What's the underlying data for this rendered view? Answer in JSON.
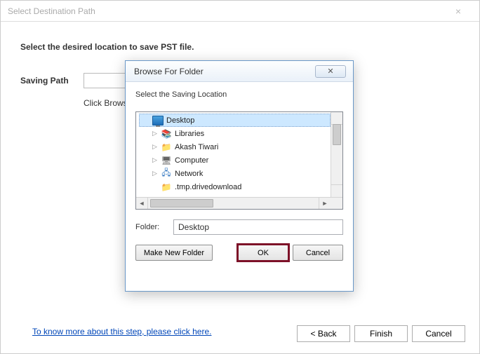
{
  "parent": {
    "title": "Select Destination Path",
    "instruction": "Select the desired location to save PST file.",
    "path_label": "Saving Path",
    "hint": "Click Browse an",
    "learn_link": "To know more about this step, please click here.",
    "back_label": "< Back",
    "finish_label": "Finish",
    "cancel_label": "Cancel"
  },
  "dialog": {
    "title": "Browse For Folder",
    "close_glyph": "✕",
    "instruction": "Select the Saving Location",
    "folder_label": "Folder:",
    "folder_value": "Desktop",
    "make_new_label": "Make New Folder",
    "ok_label": "OK",
    "cancel_label": "Cancel",
    "tree": [
      {
        "label": "Desktop",
        "icon": "monitor",
        "expandable": false,
        "selected": true,
        "indent": 0
      },
      {
        "label": "Libraries",
        "icon": "libraries",
        "expandable": true,
        "selected": false,
        "indent": 1
      },
      {
        "label": "Akash Tiwari",
        "icon": "user",
        "expandable": true,
        "selected": false,
        "indent": 1
      },
      {
        "label": "Computer",
        "icon": "computer",
        "expandable": true,
        "selected": false,
        "indent": 1
      },
      {
        "label": "Network",
        "icon": "network",
        "expandable": true,
        "selected": false,
        "indent": 1
      },
      {
        "label": ".tmp.drivedownload",
        "icon": "folder",
        "expandable": false,
        "selected": false,
        "indent": 1
      }
    ]
  }
}
